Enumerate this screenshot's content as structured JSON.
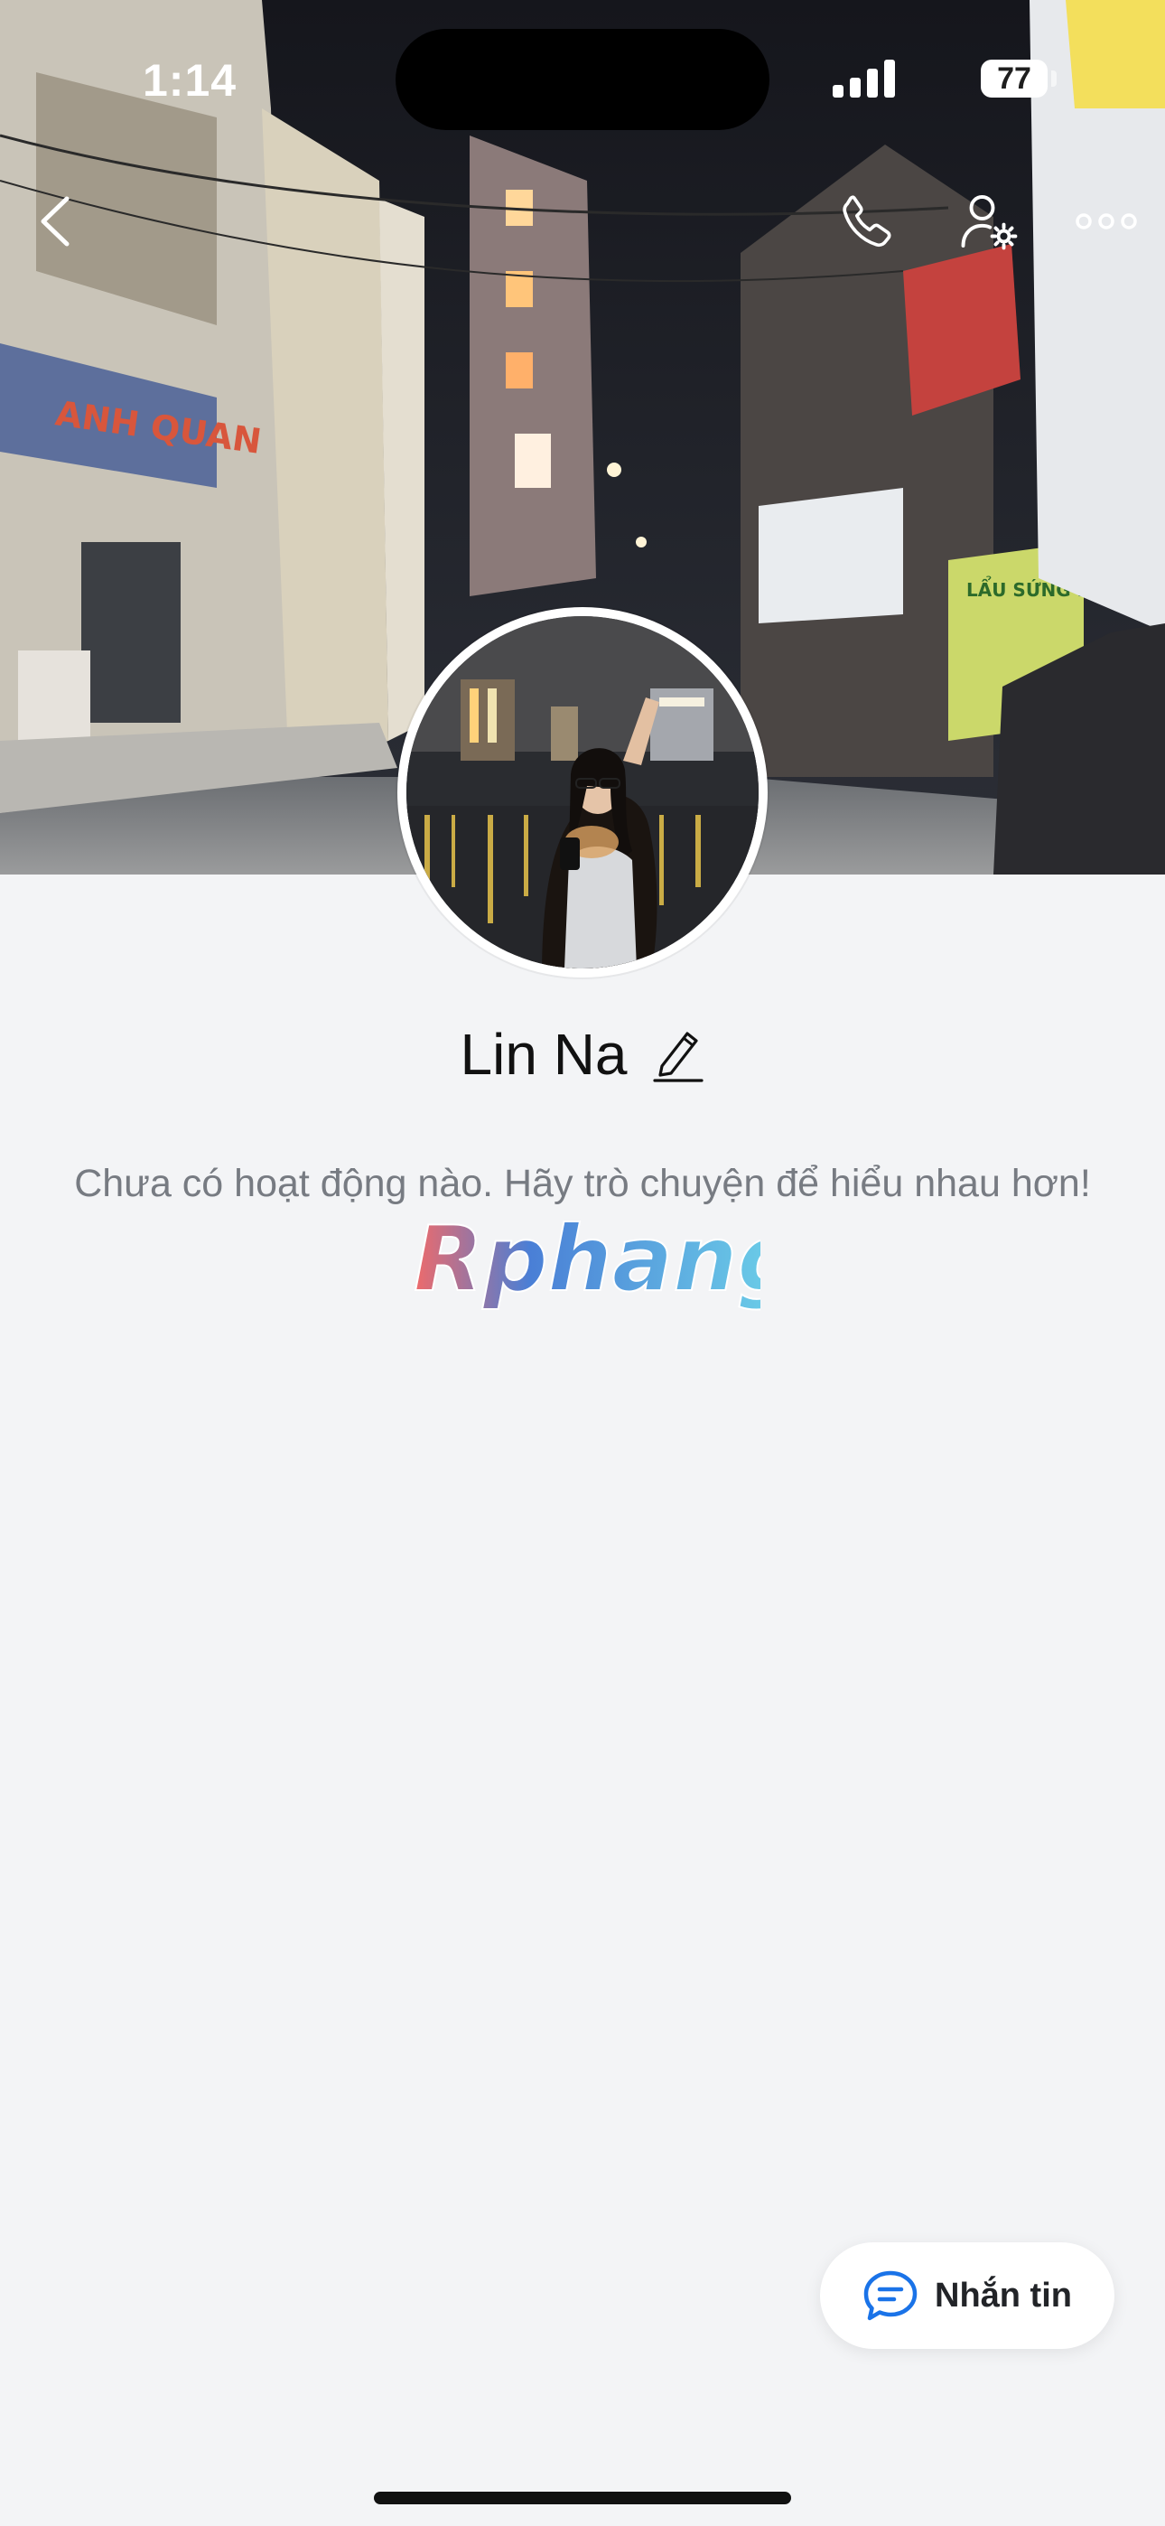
{
  "status_bar": {
    "time": "1:14",
    "battery": "77"
  },
  "profile": {
    "name": "Lin Na",
    "empty_activity_text": "Chưa có hoạt động nào. Hãy trò chuyện để hiểu nhau hơn!"
  },
  "watermark": {
    "text": "Rphang"
  },
  "actions": {
    "message_label": "Nhắn tin"
  },
  "icons": {
    "back": "chevron-left-icon",
    "call": "phone-icon",
    "profile_settings": "user-gear-icon",
    "more": "more-dots-icon",
    "edit": "pencil-icon",
    "message": "chat-bubble-icon"
  },
  "colors": {
    "background": "#f3f4f6",
    "accent": "#1a73e8",
    "text_secondary": "#777b82"
  }
}
